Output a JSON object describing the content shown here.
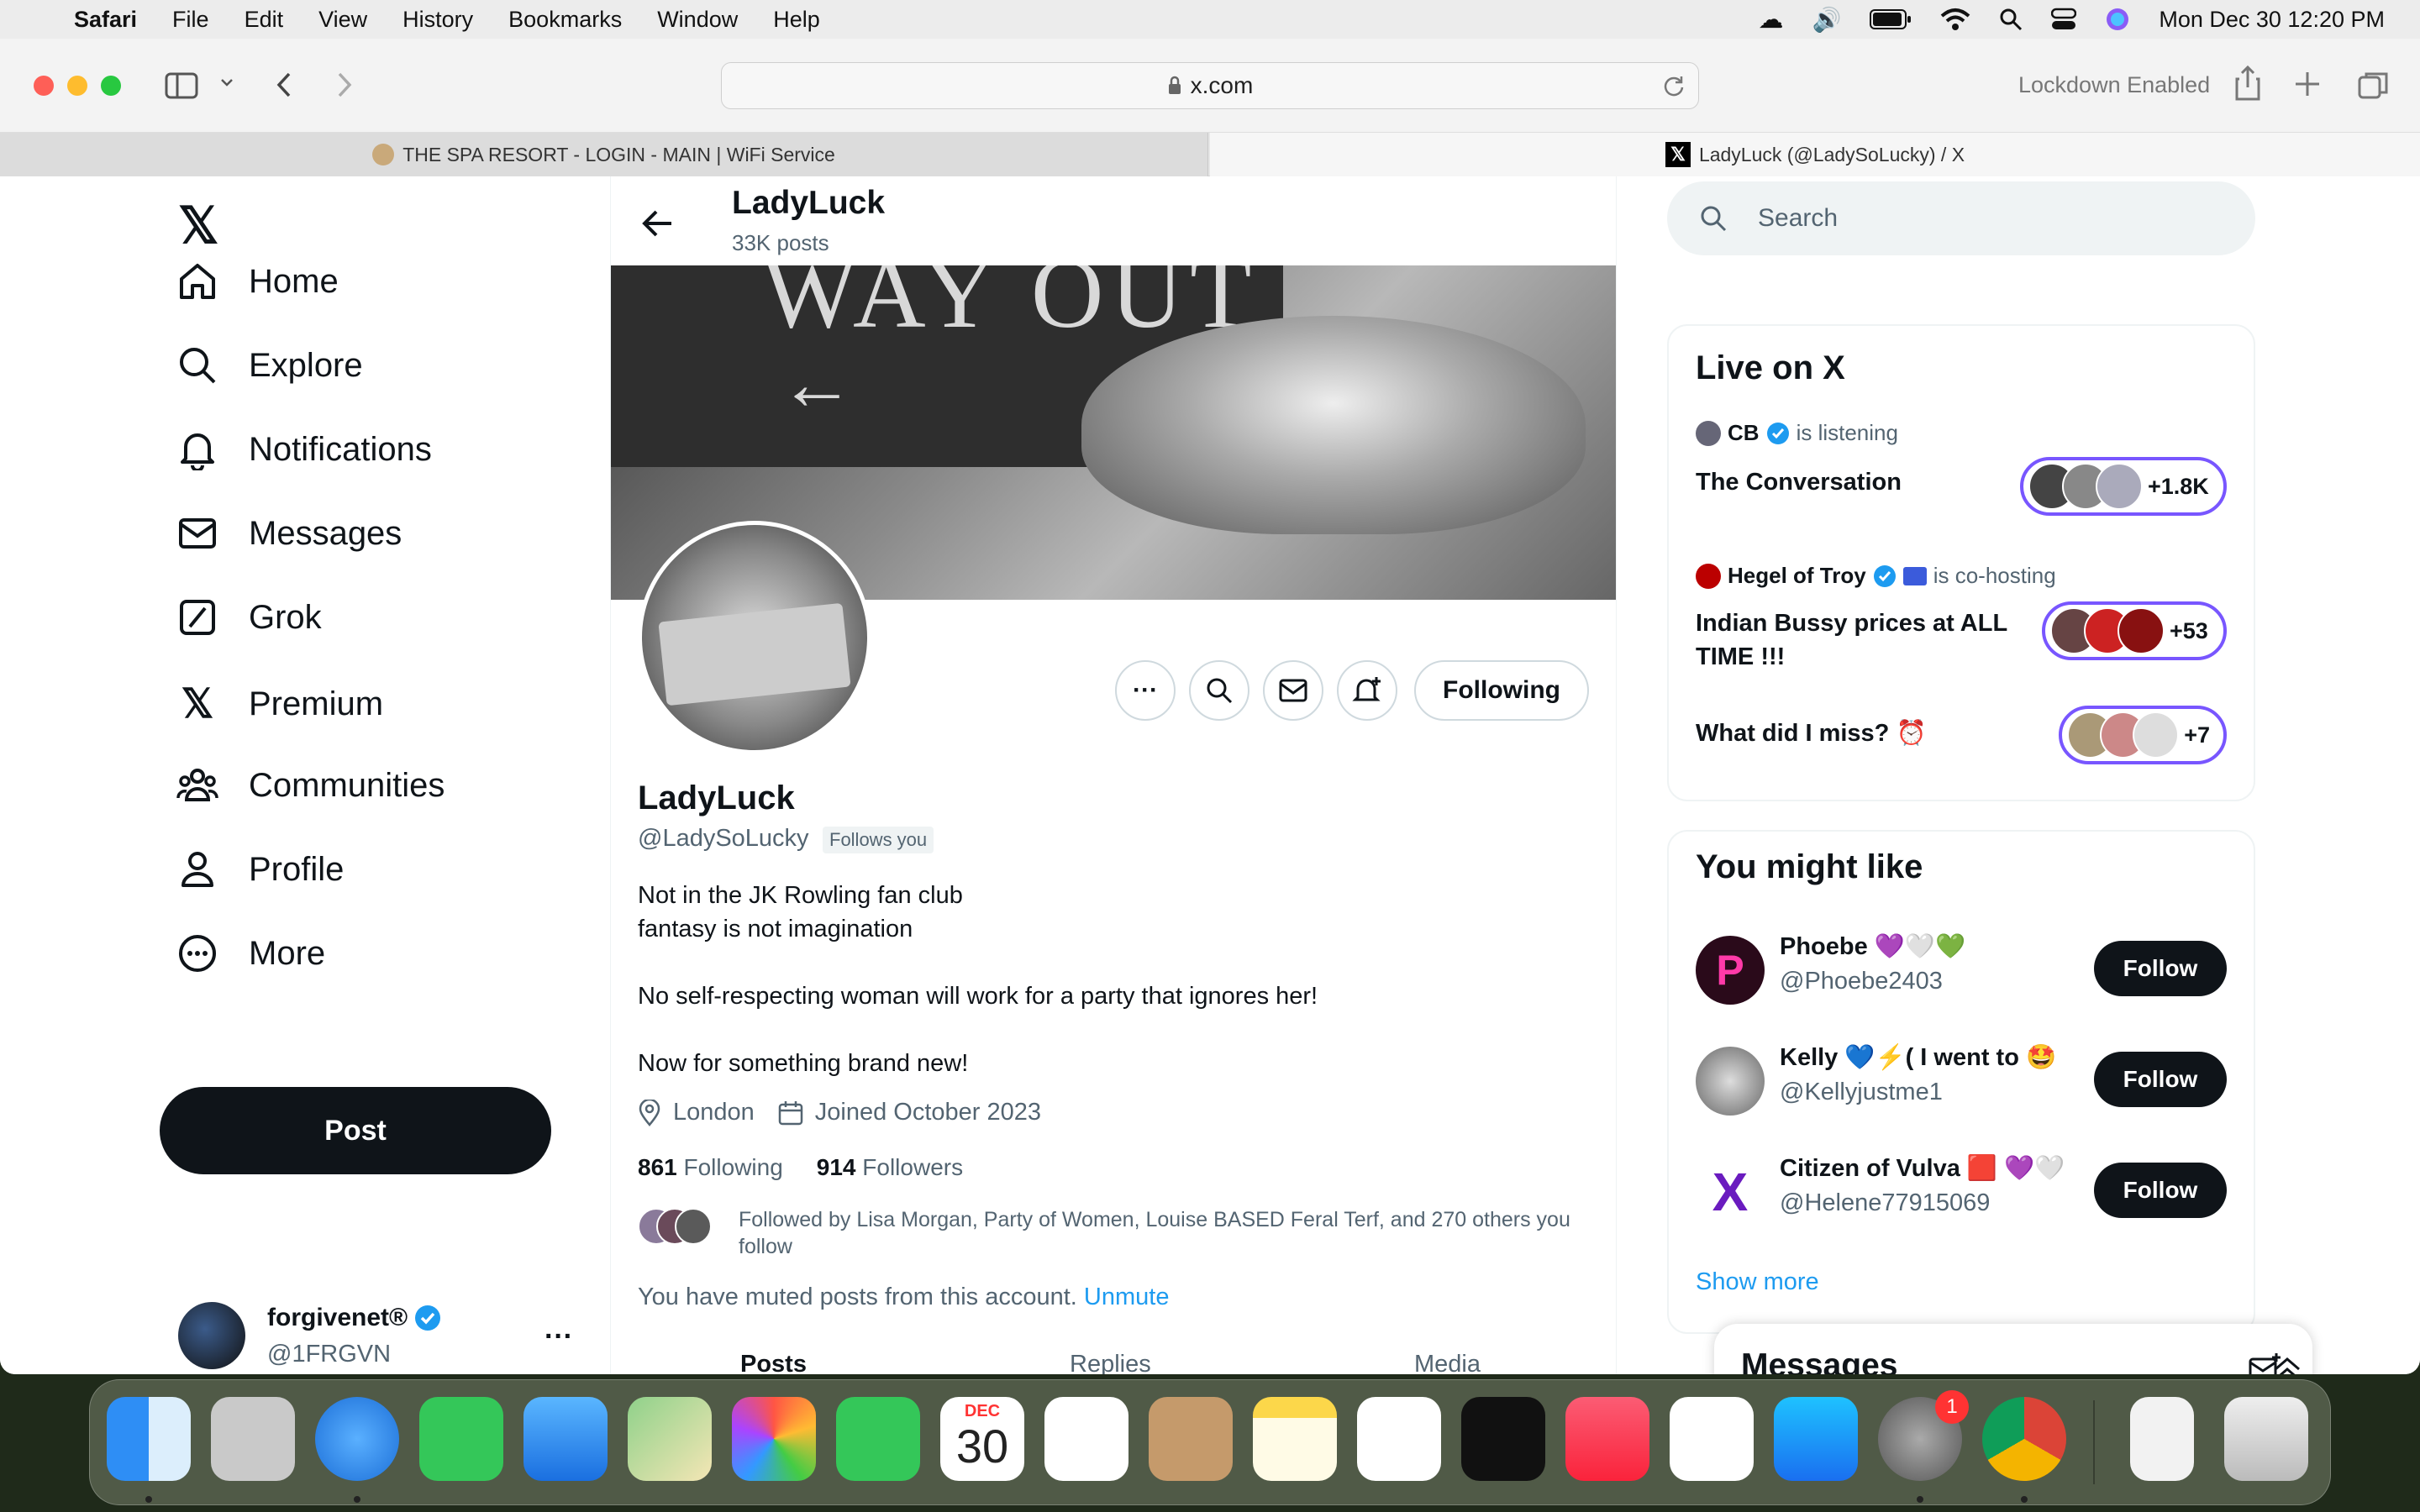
{
  "menubar": {
    "items": [
      "Safari",
      "File",
      "Edit",
      "View",
      "History",
      "Bookmarks",
      "Window",
      "Help"
    ],
    "clock": "Mon Dec 30  12:20 PM"
  },
  "toolbar": {
    "url": "x.com",
    "lockdown": "Lockdown Enabled"
  },
  "tabs": [
    {
      "label": "THE SPA RESORT - LOGIN - MAIN | WiFi Service"
    },
    {
      "label": "LadyLuck (@LadySoLucky) / X"
    }
  ],
  "nav": {
    "items": [
      "Home",
      "Explore",
      "Notifications",
      "Messages",
      "Grok",
      "Premium",
      "Communities",
      "Profile",
      "More"
    ],
    "post_label": "Post"
  },
  "account": {
    "name": "forgivenet®",
    "handle": "@1FRGVN"
  },
  "profile": {
    "header_name": "LadyLuck",
    "post_count": "33K posts",
    "name": "LadyLuck",
    "handle": "@LadySoLucky",
    "follows_you": "Follows you",
    "bio": [
      "Not in the JK  Rowling fan club",
      "fantasy is not imagination",
      "",
      "No self-respecting woman will work for a party that ignores her!",
      "",
      "Now for something brand new!"
    ],
    "location": "London",
    "joined": "Joined October 2023",
    "following_count": "861",
    "following_label": "Following",
    "followers_count": "914",
    "followers_label": "Followers",
    "followed_by": "Followed by Lisa Morgan, Party of Women, Louise BASED Feral Terf, and 270 others you follow",
    "muted_text": "You have muted posts from this account.",
    "unmute": "Unmute",
    "following_button": "Following",
    "tabs": [
      "Posts",
      "Replies",
      "Media"
    ],
    "banner_text": "WAY OUT"
  },
  "search": {
    "placeholder": "Search"
  },
  "live": {
    "title": "Live on X",
    "items": [
      {
        "host": "CB",
        "action": "is listening",
        "title": "The Conversation",
        "count": "+1.8K"
      },
      {
        "host": "Hegel of Troy",
        "action": "is co-hosting",
        "title": "Indian Bussy prices at ALL TIME !!!",
        "count": "+53"
      },
      {
        "host": "",
        "action": "",
        "title": "What did I miss? ⏰",
        "count": "+7"
      }
    ]
  },
  "suggest": {
    "title": "You might like",
    "items": [
      {
        "name": "Phoebe 💜🤍💚",
        "handle": "@Phoebe2403",
        "button": "Follow"
      },
      {
        "name": "Kelly 💙⚡( I went to 🤩",
        "handle": "@Kellyjustme1",
        "button": "Follow"
      },
      {
        "name": "Citizen of Vulva 🟥 💜🤍",
        "handle": "@Helene77915069",
        "button": "Follow"
      }
    ],
    "show_more": "Show more"
  },
  "messages_drawer": {
    "title": "Messages"
  },
  "dock": {
    "calendar_month": "DEC",
    "calendar_day": "30",
    "settings_badge": "1"
  },
  "colors": {
    "accent": "#1d9bf0",
    "live_border": "#7856ff",
    "dark": "#0f1419",
    "muted": "#536471"
  }
}
